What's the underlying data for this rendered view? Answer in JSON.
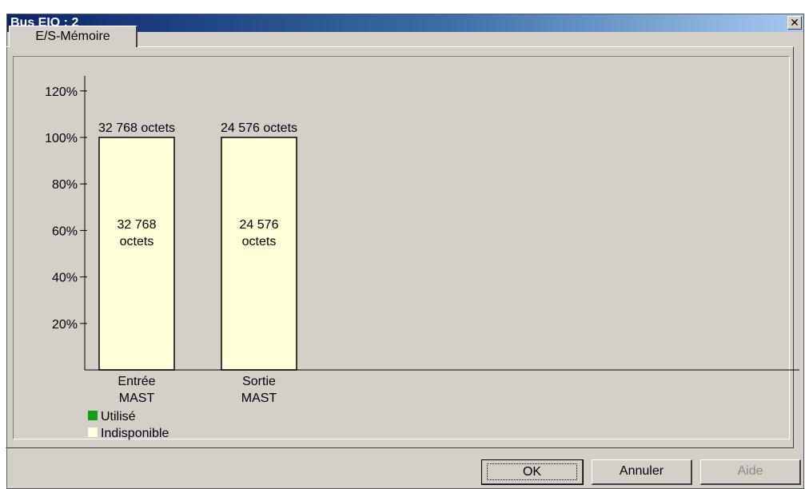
{
  "window": {
    "title": "Bus EIO : 2",
    "close_glyph": "✕",
    "close_icon": "close-icon"
  },
  "tabs": [
    {
      "label": "E/S-Mémoire",
      "active": true
    }
  ],
  "colors": {
    "used": "#1a9e1a",
    "unavailable": "#ffffd8",
    "titlebar_start": "#0a246a",
    "titlebar_end": "#a6caf0"
  },
  "chart_data": {
    "type": "bar",
    "stacked": true,
    "categories": [
      [
        "Entrée",
        "MAST"
      ],
      [
        "Sortie",
        "MAST"
      ]
    ],
    "series": [
      {
        "name": "Utilisé",
        "values": [
          0.3,
          0.3
        ],
        "color": "#1a9e1a"
      },
      {
        "name": "Indisponible",
        "values": [
          99.7,
          99.7
        ],
        "color": "#ffffd8"
      }
    ],
    "top_labels": [
      "32 768 octets",
      "24 576 octets"
    ],
    "inner_labels": [
      [
        "32 768",
        "octets"
      ],
      [
        "24 576",
        "octets"
      ]
    ],
    "yticks": [
      20,
      40,
      60,
      80,
      100,
      120
    ],
    "ytick_labels": [
      "20%",
      "40%",
      "60%",
      "80%",
      "100%",
      "120%"
    ],
    "ylim": [
      0,
      120
    ],
    "legend_position": "bottom-left"
  },
  "buttons": {
    "ok": "OK",
    "cancel": "Annuler",
    "help": "Aide"
  }
}
